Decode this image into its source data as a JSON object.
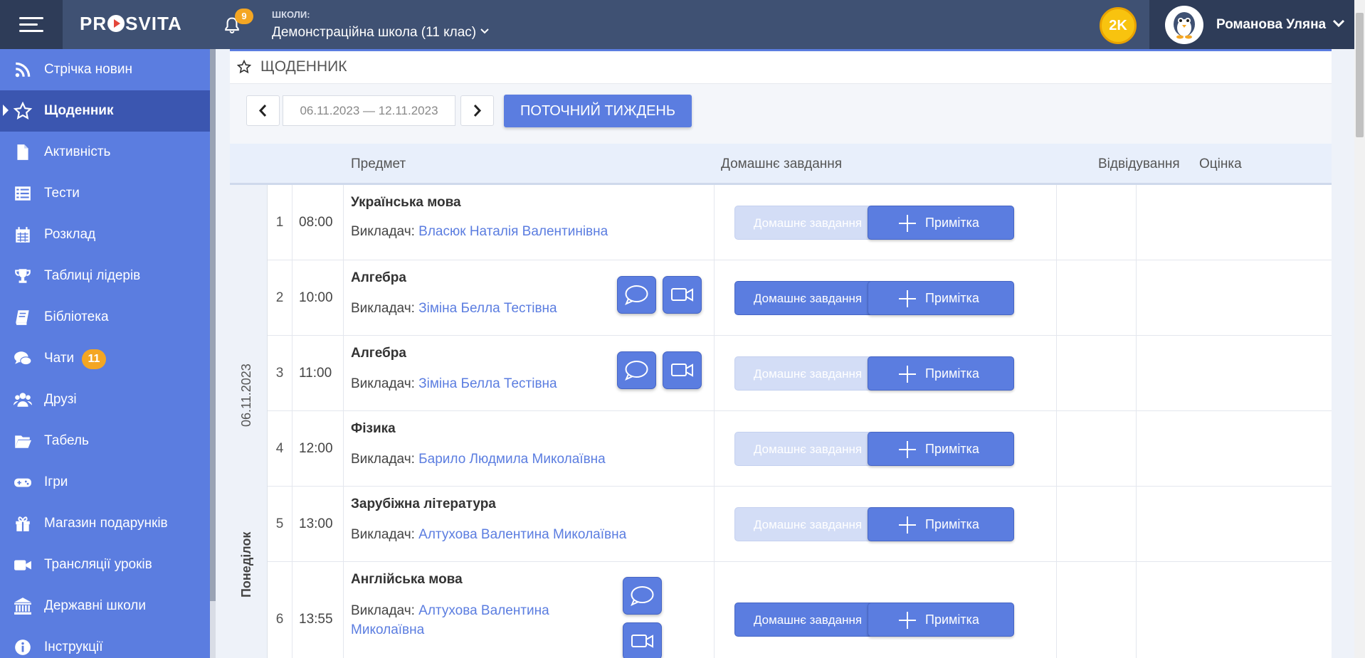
{
  "topbar": {
    "logo": "PR SVITA",
    "notifications_count": "9",
    "school_label": "ШКОЛИ:",
    "school_name": "Демонстраційна школа (11 клас)",
    "coins": "2K",
    "user_name": "Романова Уляна"
  },
  "sidebar": {
    "items": [
      {
        "label": "Стрічка новин",
        "icon": "rss-icon"
      },
      {
        "label": "Щоденник",
        "icon": "star-icon",
        "active": true
      },
      {
        "label": "Активність",
        "icon": "file-icon"
      },
      {
        "label": "Тести",
        "icon": "list-icon"
      },
      {
        "label": "Розклад",
        "icon": "calendar-icon"
      },
      {
        "label": "Таблиці лідерів",
        "icon": "trophy-icon"
      },
      {
        "label": "Бібліотека",
        "icon": "book-icon"
      },
      {
        "label": "Чати",
        "icon": "chat-icon",
        "badge": "11"
      },
      {
        "label": "Друзі",
        "icon": "users-icon"
      },
      {
        "label": "Табель",
        "icon": "folder-icon"
      },
      {
        "label": "Ігри",
        "icon": "gamepad-icon"
      },
      {
        "label": "Магазин подарунків",
        "icon": "gift-icon"
      },
      {
        "label": "Трансляції уроків",
        "icon": "video-icon"
      },
      {
        "label": "Державні школи",
        "icon": "bank-icon"
      },
      {
        "label": "Інструкції",
        "icon": "info-icon"
      }
    ]
  },
  "main": {
    "title": "ЩОДЕННИК",
    "date_range": "06.11.2023 — 12.11.2023",
    "current_week_label": "ПОТОЧНИЙ ТИЖДЕНЬ",
    "columns": {
      "subject": "Предмет",
      "homework": "Домашнє завдання",
      "attendance": "Відвідування",
      "grade": "Оцінка"
    },
    "day": {
      "date": "06.11.2023",
      "name": "Понеділок"
    },
    "teacher_prefix": "Викладач:",
    "homework_label": "Домашнє завдання",
    "note_label": "Примітка",
    "lessons": [
      {
        "num": "1",
        "time": "08:00",
        "subject": "Українська мова",
        "teacher": "Власюк Наталія Валентинівна",
        "hw_active": false
      },
      {
        "num": "2",
        "time": "10:00",
        "subject": "Алгебра",
        "teacher": "Зіміна Белла Тестівна",
        "hw_active": true
      },
      {
        "num": "3",
        "time": "11:00",
        "subject": "Алгебра",
        "teacher": "Зіміна Белла Тестівна",
        "hw_active": false
      },
      {
        "num": "4",
        "time": "12:00",
        "subject": "Фізика",
        "teacher": "Барило Людмила Миколаївна",
        "hw_active": false
      },
      {
        "num": "5",
        "time": "13:00",
        "subject": "Зарубіжна література",
        "teacher": "Алтухова Валентина Миколаївна",
        "hw_active": false
      },
      {
        "num": "6",
        "time": "13:55",
        "subject": "Англійська мова",
        "teacher_line1": "Алтухова Валентина",
        "teacher_line2": "Миколаївна",
        "hw_active": true
      }
    ]
  },
  "colors": {
    "topbar": "#3f5173",
    "sidebar": "#5b7de0",
    "sidebar_active": "#3b56b0",
    "accent": "#5b7de0",
    "badge": "#f4a623"
  }
}
